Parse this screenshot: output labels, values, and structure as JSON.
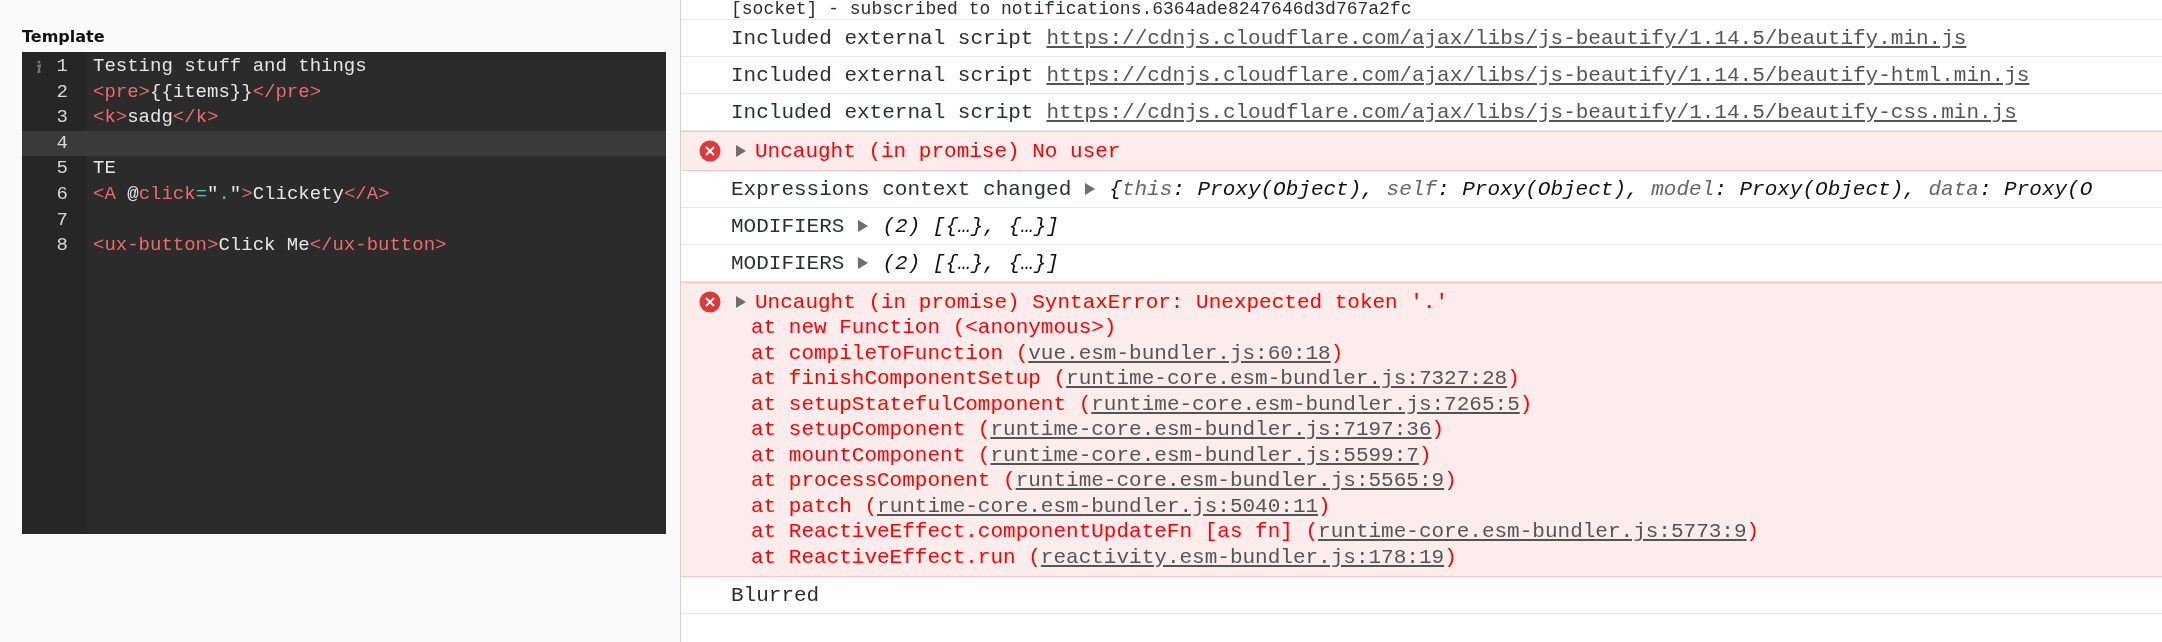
{
  "editor": {
    "label": "Template",
    "lines": [
      {
        "number": "1",
        "marker": true,
        "active": false,
        "tokens": [
          {
            "t": "Testing stuff and things",
            "kind": "text"
          }
        ]
      },
      {
        "number": "2",
        "marker": false,
        "active": false,
        "tokens": [
          {
            "t": "<pre>",
            "kind": "tag"
          },
          {
            "t": "{{items}}",
            "kind": "text"
          },
          {
            "t": "</pre>",
            "kind": "tag"
          }
        ]
      },
      {
        "number": "3",
        "marker": false,
        "active": false,
        "tokens": [
          {
            "t": "<k>",
            "kind": "tag"
          },
          {
            "t": "sadg",
            "kind": "text"
          },
          {
            "t": "</k>",
            "kind": "tag"
          }
        ]
      },
      {
        "number": "4",
        "marker": false,
        "active": true
      },
      {
        "number": "5",
        "marker": false,
        "active": false,
        "tokens": [
          {
            "t": "TE",
            "kind": "text"
          }
        ]
      },
      {
        "number": "6",
        "marker": false,
        "active": false,
        "tokens": [
          {
            "t": "<A",
            "kind": "tag"
          },
          {
            "t": " @",
            "kind": "text"
          },
          {
            "t": "click",
            "kind": "tag"
          },
          {
            "t": "=",
            "kind": "op"
          },
          {
            "t": "\"",
            "kind": "text"
          },
          {
            "t": ".",
            "kind": "op"
          },
          {
            "t": "\"",
            "kind": "text"
          },
          {
            "t": ">",
            "kind": "tag"
          },
          {
            "t": "Clickety",
            "kind": "text"
          },
          {
            "t": "</A>",
            "kind": "tag"
          }
        ]
      },
      {
        "number": "7",
        "marker": false,
        "active": false
      },
      {
        "number": "8",
        "marker": false,
        "active": false,
        "tokens": [
          {
            "t": "<ux-button>",
            "kind": "tag"
          },
          {
            "t": "Click Me",
            "kind": "text"
          },
          {
            "t": "</ux-button>",
            "kind": "tag"
          }
        ]
      }
    ]
  },
  "console": {
    "entries": [
      {
        "kind": "log",
        "text": "[socket] - subscribed to notifications.6364ade8247646d3d767a2fc"
      },
      {
        "kind": "link",
        "text": "Included external script",
        "url": "https://cdnjs.cloudflare.com/ajax/libs/js-beautify/1.14.5/beautify.min.js"
      },
      {
        "kind": "link",
        "text": "Included external script",
        "url": "https://cdnjs.cloudflare.com/ajax/libs/js-beautify/1.14.5/beautify-html.min.js"
      },
      {
        "kind": "link",
        "text": "Included external script",
        "url": "https://cdnjs.cloudflare.com/ajax/libs/js-beautify/1.14.5/beautify-css.min.js"
      },
      {
        "kind": "error",
        "text": "Uncaught (in promise) No user"
      },
      {
        "kind": "object",
        "text": "Expressions context changed",
        "preview": [
          {
            "t": "{",
            "kind": "punct"
          },
          {
            "t": "this",
            "kind": "key"
          },
          {
            "t": ": Proxy(Object), ",
            "kind": "value"
          },
          {
            "t": "self",
            "kind": "key"
          },
          {
            "t": ": Proxy(Object), ",
            "kind": "value"
          },
          {
            "t": "model",
            "kind": "key"
          },
          {
            "t": ": Proxy(Object), ",
            "kind": "value"
          },
          {
            "t": "data",
            "kind": "key"
          },
          {
            "t": ": Proxy(O",
            "kind": "value"
          }
        ]
      },
      {
        "kind": "object",
        "text": "MODIFIERS",
        "preview": [
          {
            "t": "(2) [{…}, {…}]",
            "kind": "value"
          }
        ]
      },
      {
        "kind": "object",
        "text": "MODIFIERS",
        "preview": [
          {
            "t": "(2) [{…}, {…}]",
            "kind": "value"
          }
        ]
      },
      {
        "kind": "error",
        "text": "Uncaught (in promise) SyntaxError: Unexpected token '.'",
        "stack": [
          {
            "prefix": "at new Function (<anonymous>)"
          },
          {
            "prefix": "at compileToFunction (",
            "link": "vue.esm-bundler.js:60:18",
            "suffix": ")"
          },
          {
            "prefix": "at finishComponentSetup (",
            "link": "runtime-core.esm-bundler.js:7327:28",
            "suffix": ")"
          },
          {
            "prefix": "at setupStatefulComponent (",
            "link": "runtime-core.esm-bundler.js:7265:5",
            "suffix": ")"
          },
          {
            "prefix": "at setupComponent (",
            "link": "runtime-core.esm-bundler.js:7197:36",
            "suffix": ")"
          },
          {
            "prefix": "at mountComponent (",
            "link": "runtime-core.esm-bundler.js:5599:7",
            "suffix": ")"
          },
          {
            "prefix": "at processComponent (",
            "link": "runtime-core.esm-bundler.js:5565:9",
            "suffix": ")"
          },
          {
            "prefix": "at patch (",
            "link": "runtime-core.esm-bundler.js:5040:11",
            "suffix": ")"
          },
          {
            "prefix": "at ReactiveEffect.componentUpdateFn [as fn] (",
            "link": "runtime-core.esm-bundler.js:5773:9",
            "suffix": ")"
          },
          {
            "prefix": "at ReactiveEffect.run (",
            "link": "reactivity.esm-bundler.js:178:19",
            "suffix": ")"
          }
        ]
      },
      {
        "kind": "log",
        "text": "Blurred"
      }
    ]
  }
}
